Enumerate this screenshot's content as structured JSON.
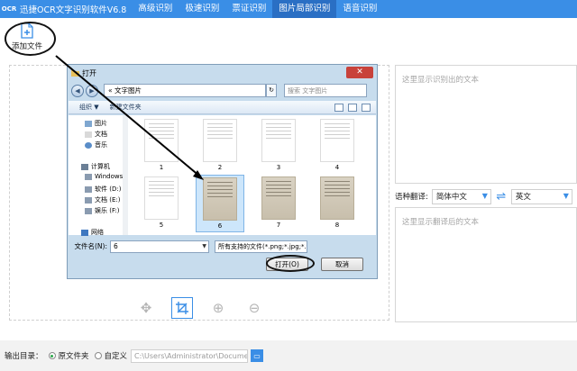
{
  "app": {
    "logo_text": "OCR",
    "title": "迅捷OCR文字识别软件V6.8",
    "tabs": [
      "高级识别",
      "极速识别",
      "票证识别",
      "图片局部识别",
      "语音识别"
    ],
    "active_tab": "图片局部识别"
  },
  "toolbar": {
    "add_file_label": "添加文件"
  },
  "right": {
    "recognized_placeholder": "这里显示识别出的文本",
    "translate_label": "语种翻译:",
    "source_lang": "简体中文",
    "target_lang": "英文",
    "translated_placeholder": "这里显示翻译后的文本"
  },
  "footer": {
    "output_label": "输出目录：",
    "option_original": "原文件夹",
    "option_custom": "自定义",
    "path": "C:\\Users\\Administrator\\Documents"
  },
  "dialog": {
    "title": "打开",
    "breadcrumb": "« 文字图片",
    "search_placeholder": "搜索 文字图片",
    "organize": "组织 ▼",
    "new_folder": "新建文件夹",
    "nav": [
      "图片",
      "文档",
      "音乐",
      "计算机",
      "Windows",
      "软件 (D:)",
      "文档 (E:)",
      "娱乐 (F:)",
      "网络"
    ],
    "thumbs": [
      "1",
      "2",
      "3",
      "4",
      "5",
      "6",
      "7",
      "8"
    ],
    "selected_thumb": "6",
    "filename_label": "文件名(N):",
    "filename_value": "6",
    "filetype": "所有支持的文件(*.png;*.jpg;*.t",
    "open_button": "打开(O)",
    "cancel_button": "取消"
  },
  "colors": {
    "accent": "#3a8ee6",
    "active_tab": "#2a6fc4",
    "footer_bg": "#f2f2f2"
  }
}
